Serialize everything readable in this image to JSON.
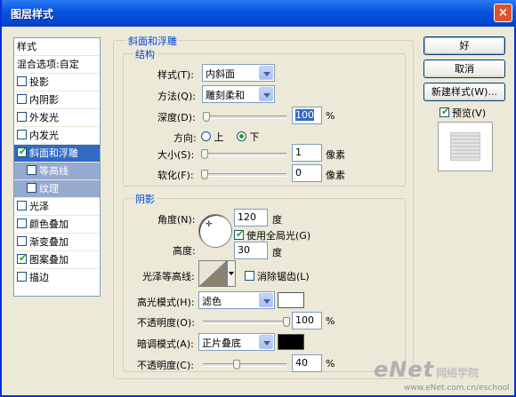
{
  "window": {
    "title": "图层样式",
    "close": "×"
  },
  "left_panel": {
    "items": [
      {
        "label": "样式",
        "type": "header"
      },
      {
        "label": "混合选项:自定",
        "type": "header"
      },
      {
        "label": "投影",
        "checked": false
      },
      {
        "label": "内阴影",
        "checked": false
      },
      {
        "label": "外发光",
        "checked": false
      },
      {
        "label": "内发光",
        "checked": false
      },
      {
        "label": "斜面和浮雕",
        "checked": true,
        "selected": true
      },
      {
        "label": "等高线",
        "checked": false,
        "sub": true
      },
      {
        "label": "纹理",
        "checked": false,
        "sub": true
      },
      {
        "label": "光泽",
        "checked": false
      },
      {
        "label": "颜色叠加",
        "checked": false
      },
      {
        "label": "渐变叠加",
        "checked": false
      },
      {
        "label": "图案叠加",
        "checked": true
      },
      {
        "label": "描边",
        "checked": false
      }
    ]
  },
  "bevel": {
    "title": "斜面和浮雕",
    "structure_title": "结构",
    "style_label": "样式(T):",
    "style_value": "内斜面",
    "technique_label": "方法(Q):",
    "technique_value": "雕刻柔和",
    "depth_label": "深度(D):",
    "depth_value": "100",
    "depth_unit": "%",
    "depth_fraction": 0.02,
    "direction_label": "方向:",
    "dir_up": "上",
    "dir_down": "下",
    "size_label": "大小(S):",
    "size_value": "1",
    "size_unit": "像素",
    "size_fraction": 0.0,
    "soften_label": "软化(F):",
    "soften_value": "0",
    "soften_unit": "像素",
    "soften_fraction": 0.0
  },
  "shading": {
    "title": "阴影",
    "angle_label": "角度(N):",
    "angle_value": "120",
    "angle_unit": "度",
    "global_light_label": "使用全局光(G)",
    "altitude_label": "高度:",
    "altitude_value": "30",
    "altitude_unit": "度",
    "gloss_contour_label": "光泽等高线:",
    "anti_alias_label": "消除锯齿(L)",
    "highlight_mode_label": "高光模式(H):",
    "highlight_mode_value": "滤色",
    "highlight_color": "#FFFFFF",
    "highlight_opacity_label": "不透明度(O):",
    "highlight_opacity_value": "100",
    "highlight_opacity_unit": "%",
    "highlight_opacity_fraction": 1.0,
    "shadow_mode_label": "暗调模式(A):",
    "shadow_mode_value": "正片叠底",
    "shadow_color": "#000000",
    "shadow_opacity_label": "不透明度(C):",
    "shadow_opacity_value": "40",
    "shadow_opacity_unit": "%",
    "shadow_opacity_fraction": 0.4
  },
  "buttons": {
    "ok": "好",
    "cancel": "取消",
    "new_style": "新建样式(W)...",
    "preview": "预览(V)"
  },
  "watermark": {
    "logo": "eNet",
    "logo_cn": "网络学院",
    "url": "www.eNet.com.cn/eschool"
  }
}
